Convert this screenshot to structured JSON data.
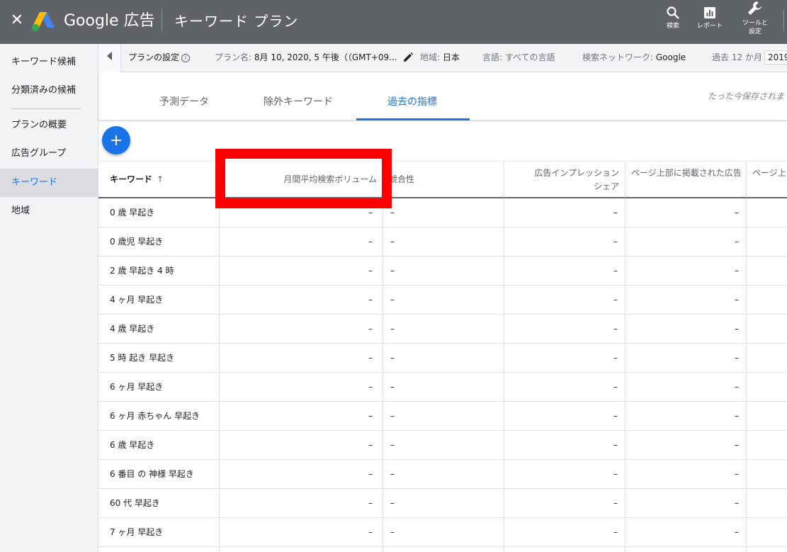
{
  "header": {
    "close_icon": "close-icon",
    "brand": "Google 広告",
    "title": "キーワード プラン",
    "tools": [
      {
        "icon": "search-icon",
        "label": "検索"
      },
      {
        "icon": "report-icon",
        "label": "レポート"
      },
      {
        "icon": "wrench-icon",
        "label_line1": "ツールと",
        "label_line2": "設定"
      }
    ]
  },
  "sidebar": {
    "items": [
      {
        "label": "キーワード候補"
      },
      {
        "label": "分類済みの候補"
      },
      {
        "label": "プランの概要"
      },
      {
        "label": "広告グループ"
      },
      {
        "label": "キーワード",
        "active": true
      },
      {
        "label": "地域"
      }
    ]
  },
  "settings": {
    "plan_settings": "プランの設定",
    "plan_name_label": "プラン名:",
    "plan_name_value": "8月 10, 2020, 5 午後（（GMT+09...",
    "region_label": "地域:",
    "region_value": "日本",
    "language_label": "言語:",
    "language_value": "すべての言語",
    "network_label": "検索ネットワーク:",
    "network_value": "Google",
    "period_label": "過去 12 か月",
    "period_value": "2019"
  },
  "tabs": [
    {
      "label": "予測データ"
    },
    {
      "label": "除外キーワード"
    },
    {
      "label": "過去の指標",
      "active": true
    }
  ],
  "saved_status": "たった今保存されま",
  "table": {
    "headers": [
      "キーワード",
      "月間平均検索ボリューム",
      "競合性",
      "広告インプレッションシェア",
      "ページ上部に掲載された広告",
      "ページ上"
    ],
    "header_impression_line1": "広告インプレッション",
    "header_impression_line2": "シェア",
    "sort_indicator": "↑",
    "rows": [
      {
        "keyword": "0 歳 早起き",
        "volume": "–",
        "competition": "–",
        "impression": "–",
        "top": "–"
      },
      {
        "keyword": "0 歳児 早起き",
        "volume": "–",
        "competition": "–",
        "impression": "–",
        "top": "–"
      },
      {
        "keyword": "2 歳 早起き 4 時",
        "volume": "–",
        "competition": "–",
        "impression": "–",
        "top": "–"
      },
      {
        "keyword": "4 ヶ月 早起き",
        "volume": "–",
        "competition": "–",
        "impression": "–",
        "top": "–"
      },
      {
        "keyword": "4 歳 早起き",
        "volume": "–",
        "competition": "–",
        "impression": "–",
        "top": "–"
      },
      {
        "keyword": "5 時 起き 早起き",
        "volume": "–",
        "competition": "–",
        "impression": "–",
        "top": "–"
      },
      {
        "keyword": "6 ヶ月 早起き",
        "volume": "–",
        "competition": "–",
        "impression": "–",
        "top": "–"
      },
      {
        "keyword": "6 ヶ月 赤ちゃん 早起き",
        "volume": "–",
        "competition": "–",
        "impression": "–",
        "top": "–"
      },
      {
        "keyword": "6 歳 早起き",
        "volume": "–",
        "competition": "–",
        "impression": "–",
        "top": "–"
      },
      {
        "keyword": "6 番目 の 神様 早起き",
        "volume": "–",
        "competition": "–",
        "impression": "–",
        "top": "–"
      },
      {
        "keyword": "60 代 早起き",
        "volume": "–",
        "competition": "–",
        "impression": "–",
        "top": "–"
      },
      {
        "keyword": "7 ヶ月 早起き",
        "volume": "–",
        "competition": "–",
        "impression": "–",
        "top": "–"
      },
      {
        "keyword": "",
        "volume": "",
        "competition": "",
        "impression": "",
        "top": ""
      }
    ]
  },
  "colors": {
    "header_bg": "#5f6368",
    "accent": "#1a73e8",
    "highlight": "#ff0000"
  }
}
